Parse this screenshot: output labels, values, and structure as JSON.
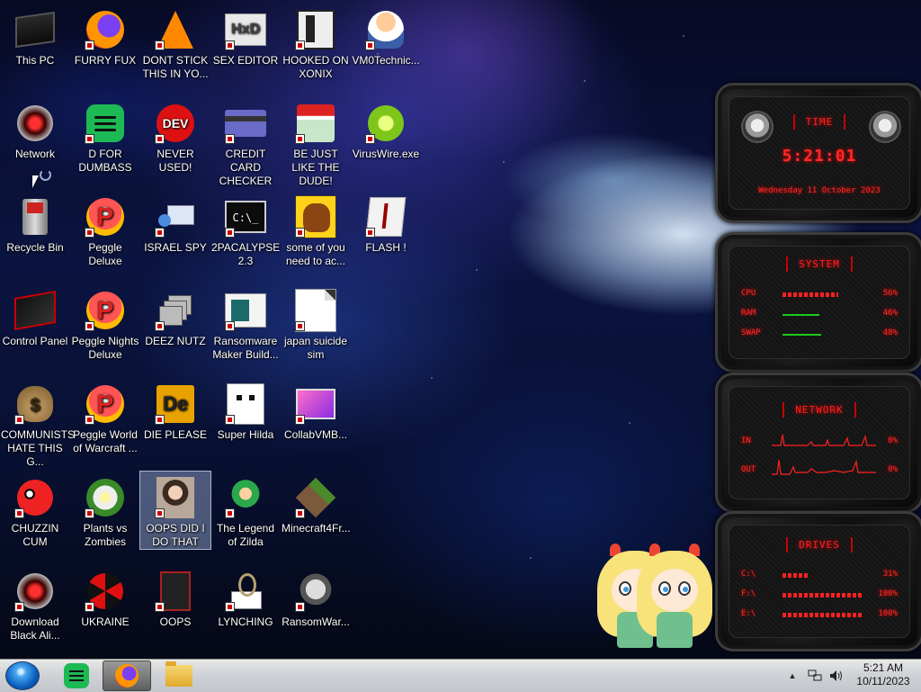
{
  "desktop": {
    "icons": [
      {
        "label": "This PC",
        "icon": "computer-icon"
      },
      {
        "label": "FURRY FUX",
        "icon": "firefox-icon"
      },
      {
        "label": "DONT STICK THIS IN YO...",
        "icon": "vlc-cone-icon"
      },
      {
        "label": "SEX EDITOR",
        "icon": "hxd-icon"
      },
      {
        "label": "HOOKED ON XONIX",
        "icon": "xonix-icon"
      },
      {
        "label": "VM0Technic...",
        "icon": "doctor-icon"
      },
      {
        "label": "Network",
        "icon": "alien-network-icon"
      },
      {
        "label": "D FOR DUMBASS",
        "icon": "spotify-icon"
      },
      {
        "label": "NEVER USED!",
        "icon": "devcpp-icon"
      },
      {
        "label": "CREDIT CARD CHECKER",
        "icon": "credit-card-icon"
      },
      {
        "label": "BE JUST LIKE THE DUDE!",
        "icon": "santa-icon"
      },
      {
        "label": "VirusWire.exe",
        "icon": "lime-icon"
      },
      {
        "label": "Recycle Bin",
        "icon": "recycle-bin-icon"
      },
      {
        "label": "Peggle Deluxe",
        "icon": "peggle-icon"
      },
      {
        "label": "ISRAEL SPY",
        "icon": "spy-screen-icon"
      },
      {
        "label": "2PACALYPSE 2.3",
        "icon": "terminal-icon"
      },
      {
        "label": "some of you need to ac...",
        "icon": "dog-icon"
      },
      {
        "label": "FLASH !",
        "icon": "flash-icon"
      },
      {
        "label": "Control Panel",
        "icon": "control-panel-icon"
      },
      {
        "label": "Peggle Nights Deluxe",
        "icon": "peggle-nights-icon"
      },
      {
        "label": "DEEZ NUTZ",
        "icon": "stacked-windows-icon"
      },
      {
        "label": "Ransomware Maker Build...",
        "icon": "ransomware-maker-icon"
      },
      {
        "label": "japan suicide sim",
        "icon": "document-icon"
      },
      {
        "label": "COMMUNISTS HATE THIS G...",
        "icon": "money-bag-icon"
      },
      {
        "label": "Peggle World of Warcraft ...",
        "icon": "peggle-wow-icon"
      },
      {
        "label": "DIE PLEASE",
        "icon": "de-icon"
      },
      {
        "label": "Super Hilda",
        "icon": "hilda-icon"
      },
      {
        "label": "CollabVMB...",
        "icon": "collabvm-icon"
      },
      {
        "label": "CHUZZIN CUM",
        "icon": "chuzzle-icon"
      },
      {
        "label": "Plants vs Zombies",
        "icon": "plants-vs-zombies-icon"
      },
      {
        "label": "OOPS DID I DO THAT",
        "icon": "portrait-icon"
      },
      {
        "label": "The Legend of Zilda",
        "icon": "zilda-icon"
      },
      {
        "label": "Minecraft4Fr...",
        "icon": "minecraft-icon"
      },
      {
        "label": "Download Black Ali...",
        "icon": "alien-download-icon"
      },
      {
        "label": "UKRAINE",
        "icon": "radiation-icon"
      },
      {
        "label": "OOPS",
        "icon": "oops-icon"
      },
      {
        "label": "LYNCHING",
        "icon": "lynching-icon"
      },
      {
        "label": "RansomWar...",
        "icon": "skull-icon"
      }
    ]
  },
  "gadgets": {
    "time": {
      "title": "TIME",
      "clock": "5:21:01",
      "date": "Wednesday 11 October 2023"
    },
    "system": {
      "title": "SYSTEM",
      "rows": [
        {
          "label": "CPU",
          "value": "56%",
          "level": 0.56
        },
        {
          "label": "RAM",
          "value": "46%",
          "level": 0.46
        },
        {
          "label": "SWAP",
          "value": "48%",
          "level": 0.48
        }
      ]
    },
    "network": {
      "title": "NETWORK",
      "rows": [
        {
          "label": "IN",
          "value": "0%"
        },
        {
          "label": "OUT",
          "value": "0%"
        }
      ]
    },
    "drives": {
      "title": "DRIVES",
      "rows": [
        {
          "label": "C:\\",
          "value": "31%",
          "level": 0.31
        },
        {
          "label": "F:\\",
          "value": "100%",
          "level": 1.0
        },
        {
          "label": "E:\\",
          "value": "100%",
          "level": 1.0
        }
      ]
    }
  },
  "taskbar": {
    "buttons": [
      {
        "icon": "start-orb-icon"
      },
      {
        "icon": "spotify-icon"
      },
      {
        "icon": "firefox-icon",
        "active": true
      },
      {
        "icon": "file-explorer-icon"
      }
    ],
    "tray": {
      "icons": [
        "show-hidden-icon",
        "network-icon",
        "volume-icon"
      ],
      "time": "5:21 AM",
      "date": "10/11/2023"
    }
  }
}
